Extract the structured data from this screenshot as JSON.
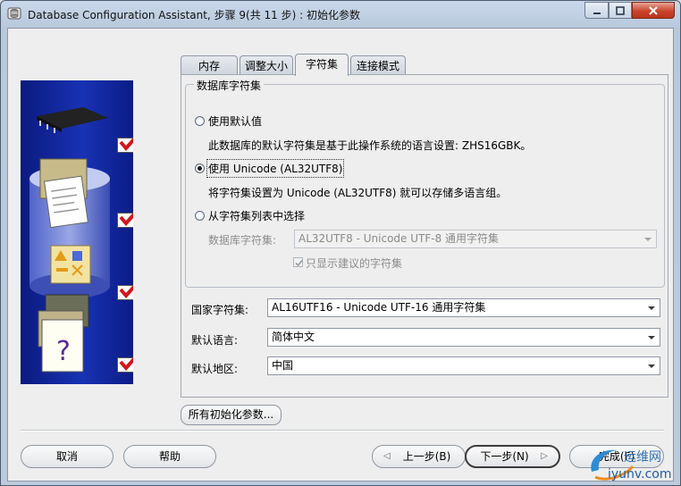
{
  "window": {
    "title": "Database Configuration Assistant, 步骤 9(共 11 步) : 初始化参数"
  },
  "tabs": [
    {
      "label": "内存"
    },
    {
      "label": "调整大小"
    },
    {
      "label": "字符集"
    },
    {
      "label": "连接模式"
    }
  ],
  "charset_group": {
    "title": "数据库字符集",
    "option_default": {
      "label": "使用默认值",
      "description": "此数据库的默认字符集是基于此操作系统的语言设置: ZHS16GBK。"
    },
    "option_unicode": {
      "label": "使用 Unicode (AL32UTF8)",
      "description": "将字符集设置为 Unicode (AL32UTF8) 就可以存储多语言组。"
    },
    "option_list": {
      "label": "从字符集列表中选择"
    },
    "db_charset_label": "数据库字符集:",
    "db_charset_value": "AL32UTF8 - Unicode UTF-8 通用字符集",
    "show_recommended_label": "只显示建议的字符集"
  },
  "national_charset": {
    "label": "国家字符集:",
    "value": "AL16UTF16 - Unicode UTF-16 通用字符集"
  },
  "default_language": {
    "label": "默认语言:",
    "value": "简体中文"
  },
  "default_territory": {
    "label": "默认地区:",
    "value": "中国"
  },
  "buttons": {
    "all_params": "所有初始化参数...",
    "cancel": "取消",
    "help": "帮助",
    "back": "上一步(B)",
    "next": "下一步(N)",
    "finish": "完成(F)"
  },
  "watermark": {
    "line1": "运维网",
    "line2": "iyunv.com"
  },
  "icons": {
    "app": "database-config-icon",
    "art": [
      "memory-chip-icon",
      "file-documents-icon",
      "shapes-icon",
      "help-documents-icon",
      "checkmark-icon"
    ]
  },
  "state": {
    "active_tab": "字符集",
    "selected_charset_option": "使用 Unicode (AL32UTF8)",
    "show_recommended_checked": true
  },
  "colors": {
    "art_background": "#1832b4",
    "checkmark": "#d4141c",
    "close_button": "#c9452c"
  }
}
